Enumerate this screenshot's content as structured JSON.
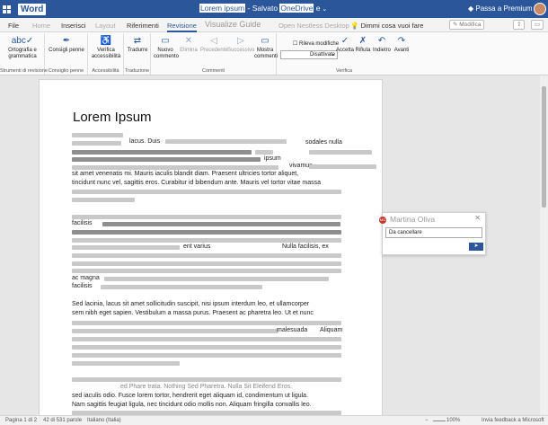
{
  "app": {
    "name": "Word",
    "doc_title_part1": "Lorem ipsum",
    "doc_title_part2": " - Salvato ",
    "doc_title_highlight": "OneDrive",
    "doc_title_part3": " e",
    "premium": "Passa a Premium"
  },
  "tabs": [
    {
      "label": "File"
    },
    {
      "label": "Home"
    },
    {
      "label": "Inserisci"
    },
    {
      "label": "Layout"
    },
    {
      "label": "Riferimenti"
    },
    {
      "label": "Revisione"
    },
    {
      "label": "Visualize Guide"
    },
    {
      "label": "Open Nestless Desktop"
    }
  ],
  "tell_me": "Dimmi cosa vuoi fare",
  "tab_right": {
    "modify": "Modifica"
  },
  "ribbon": {
    "spelling": "Ortografia e grammatica",
    "spelling_group": "Strumenti di revisione",
    "suggestions": "Consigli penne",
    "suggestions_group": "Consiglio penne",
    "accessibility": "Verifica accessibilità",
    "accessibility_group": "Accessibilità",
    "translate": "Tradurre",
    "translate_group": "Traduzione",
    "new_comment": "Nuovo commento",
    "delete": "Elimina",
    "previous": "Precedente",
    "next": "Successivo",
    "show_comments": "Mostra commenti",
    "comments_group": "Commenti",
    "track_label": "Rileva modifiche",
    "track_value": "Disattivate",
    "accept": "Accetta",
    "reject": "Rifiuta",
    "back": "Indietro",
    "forward": "Avanti",
    "verify_group": "Verifica"
  },
  "document": {
    "title": "Lorem Ipsum",
    "fragments": {
      "f1": "lacus. Duis",
      "f2": "sodales nulla",
      "f3": "ipsum",
      "f4": "vivamus",
      "f5": "sit amet venenatis mi. Mauris iaculis blandit diam. Praesent ultricies tortor aliquet,",
      "f6": "tincidunt nunc vel, sagittis eros. Curabitur id bibendum ante. Mauris vel tortor vitae massa",
      "f7": "facilisis",
      "f8": "ent varius",
      "f9": "Nulla facilisis, ex",
      "f10": "ac magna",
      "f11": "facilisis",
      "f12": "Sed lacinia, lacus sit amet sollicitudin suscipit, nisi ipsum interdum leo, et ullamcorper",
      "f13": "sem nibh eget sapien. Vestibulum a massa purus. Praesent ac pharetra leo. Ut et nunc",
      "f14": "malesuada",
      "f15": "Aliquam",
      "f16": "ed Phare trata. Nothing Sed Pharetra. Nulla Sit Eleifend Eros.",
      "f17": "sed iaculis odio. Fusce lorem tortor, hendrerit eget aliquam id, condimentum ut ligula.",
      "f18": "Nam sagittis feugiat ligula, nec tincidunt odio mollis non. Aliquam fringilla convallis leo."
    }
  },
  "comment": {
    "author": "Martina Oliva",
    "text": "Da cancellare",
    "avatar_initials": "MO"
  },
  "status": {
    "page": "Pagina 1 di 2",
    "words": "42 di 531 parole",
    "lang": "Italiano (Italia)",
    "zoom": "100%",
    "feedback": "Invia feedback a Microsoft"
  },
  "colors": {
    "brand": "#2b579a",
    "comment_avatar": "#c0392b"
  }
}
